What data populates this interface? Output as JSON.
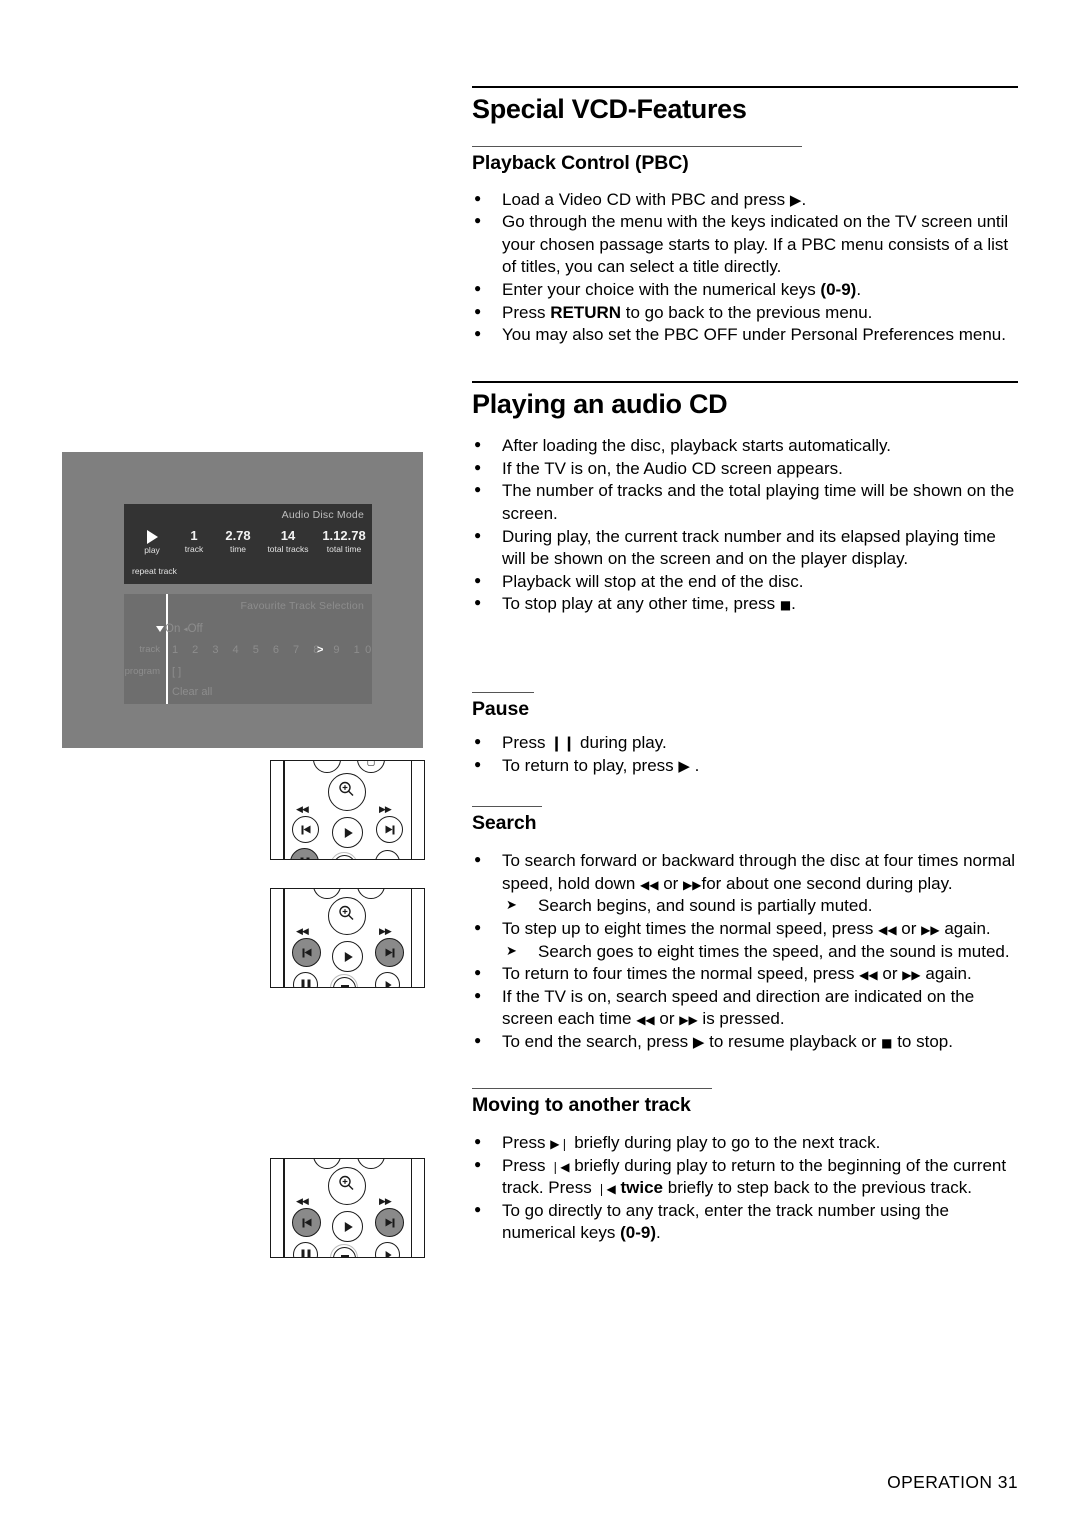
{
  "page": {
    "footer": "OPERATION  31"
  },
  "sections": {
    "vcd": {
      "title": "Special VCD-Features",
      "sub": {
        "title": "Playback Control (PBC)",
        "bullets": [
          {
            "parts": [
              {
                "t": "Load a Video CD with PBC and press "
              },
              {
                "t": "▶",
                "style": "glyph"
              },
              {
                "t": "."
              }
            ]
          },
          {
            "parts": [
              {
                "t": "Go through the menu with the keys indicated on the TV screen until your chosen passage starts to play. If a PBC menu consists of a list of titles, you can select a title directly."
              }
            ]
          },
          {
            "parts": [
              {
                "t": "Enter your choice with the numerical keys "
              },
              {
                "t": "(0-9)",
                "style": "bold"
              },
              {
                "t": "."
              }
            ]
          },
          {
            "parts": [
              {
                "t": "Press "
              },
              {
                "t": "RETURN",
                "style": "bold"
              },
              {
                "t": " to go back to the previous menu."
              }
            ]
          },
          {
            "parts": [
              {
                "t": "You may also set the PBC OFF under Personal Preferences menu."
              }
            ]
          }
        ]
      }
    },
    "audiocd": {
      "title": "Playing an audio CD",
      "bullets": [
        {
          "parts": [
            {
              "t": "After loading the disc, playback starts automatically."
            }
          ]
        },
        {
          "parts": [
            {
              "t": "If the TV is on, the Audio CD screen appears."
            }
          ]
        },
        {
          "parts": [
            {
              "t": "The number of tracks and the total playing time will be shown on the screen."
            }
          ]
        },
        {
          "parts": [
            {
              "t": "During play, the current track number and its elapsed playing time will be shown on the screen and on the player display."
            }
          ]
        },
        {
          "parts": [
            {
              "t": "Playback will stop at the end of the disc."
            }
          ]
        },
        {
          "parts": [
            {
              "t": "To stop play at any other time, press "
            },
            {
              "t": "■",
              "style": "glyph-sm"
            },
            {
              "t": "."
            }
          ]
        }
      ]
    },
    "pause": {
      "title": "Pause",
      "bullets": [
        {
          "parts": [
            {
              "t": "Press "
            },
            {
              "t": "❙❙",
              "style": "bold-glyph"
            },
            {
              "t": " during play."
            }
          ]
        },
        {
          "parts": [
            {
              "t": "To return to play, press "
            },
            {
              "t": "▶",
              "style": "glyph"
            },
            {
              "t": " ."
            }
          ]
        }
      ]
    },
    "search": {
      "title": "Search",
      "bullets": [
        {
          "level": 1,
          "parts": [
            {
              "t": "To search forward or backward through the disc at four times normal speed, hold down "
            },
            {
              "t": "◀◀",
              "style": "glyph-sm"
            },
            {
              "t": "  or  "
            },
            {
              "t": "▶▶",
              "style": "glyph-sm"
            },
            {
              "t": "for about one second during play."
            }
          ]
        },
        {
          "level": 2,
          "parts": [
            {
              "t": "Search begins, and sound is partially muted."
            }
          ]
        },
        {
          "level": 1,
          "parts": [
            {
              "t": "To step up to eight times the normal speed, press "
            },
            {
              "t": "◀◀",
              "style": "glyph-sm"
            },
            {
              "t": " or "
            },
            {
              "t": "▶▶",
              "style": "glyph-sm"
            },
            {
              "t": " again."
            }
          ]
        },
        {
          "level": 2,
          "parts": [
            {
              "t": "Search goes to eight times the speed, and the sound is muted."
            }
          ]
        },
        {
          "level": 1,
          "parts": [
            {
              "t": "To return to four times the normal speed, press "
            },
            {
              "t": "◀◀",
              "style": "glyph-sm"
            },
            {
              "t": "  or  "
            },
            {
              "t": "▶▶",
              "style": "glyph-sm"
            },
            {
              "t": " again."
            }
          ]
        },
        {
          "level": 1,
          "parts": [
            {
              "t": "If the TV is on, search speed and direction are indicated on the screen each time "
            },
            {
              "t": "◀◀",
              "style": "glyph-sm"
            },
            {
              "t": "  or  "
            },
            {
              "t": "▶▶",
              "style": "glyph-sm"
            },
            {
              "t": "  is pressed."
            }
          ]
        },
        {
          "level": 1,
          "parts": [
            {
              "t": "To end the search, press "
            },
            {
              "t": "▶",
              "style": "glyph"
            },
            {
              "t": " to resume playback or "
            },
            {
              "t": "■",
              "style": "glyph-sm"
            },
            {
              "t": " to stop."
            }
          ]
        }
      ]
    },
    "moving": {
      "title": "Moving to another track",
      "bullets": [
        {
          "parts": [
            {
              "t": "Press "
            },
            {
              "t": "▶❘",
              "style": "glyph-sm"
            },
            {
              "t": " briefly during play to go to the next track."
            }
          ]
        },
        {
          "parts": [
            {
              "t": "Press "
            },
            {
              "t": "❘◀",
              "style": "glyph-sm"
            },
            {
              "t": " briefly during play to return to the beginning of the current track. Press "
            },
            {
              "t": "❘◀",
              "style": "glyph-sm"
            },
            {
              "t": " "
            },
            {
              "t": "twice",
              "style": "bold"
            },
            {
              "t": " briefly to step back to the previous track."
            }
          ]
        },
        {
          "parts": [
            {
              "t": "To go directly to any track, enter the track number using the numerical keys "
            },
            {
              "t": "(0-9)",
              "style": "bold"
            },
            {
              "t": "."
            }
          ]
        }
      ]
    }
  },
  "tv_screen": {
    "disc_panel": {
      "title": "Audio Disc Mode",
      "fields": [
        {
          "value": "▶",
          "label": "play",
          "is_icon": true
        },
        {
          "value": "1",
          "label": "track"
        },
        {
          "value": "2.78",
          "label": "time"
        },
        {
          "value": "14",
          "label": "total tracks"
        },
        {
          "value": "1.12.78",
          "label": "total time"
        }
      ],
      "status": "repeat track"
    },
    "fts_panel": {
      "title": "Favourite Track Selection",
      "on_label": "On",
      "off_label": "Off",
      "rows": [
        {
          "label": "track",
          "value": "1 2 3 4 5  6 7 8  9  10",
          "arrow": ">"
        },
        {
          "label": "program",
          "value": "[ ]"
        },
        {
          "label": "",
          "value": "Clear all"
        }
      ]
    }
  },
  "remotes": [
    {
      "name": "pause-remote",
      "highlighted": [
        "pause"
      ]
    },
    {
      "name": "search-remote",
      "highlighted": [
        "prev",
        "next"
      ]
    },
    {
      "name": "track-remote",
      "highlighted": [
        "prev",
        "next"
      ]
    }
  ],
  "colors": {
    "tv_frame": "#7f7f7f",
    "osd_dark": "#333333",
    "osd_mid": "#6e6e6e",
    "button_highlight": "#8a8a8a"
  }
}
